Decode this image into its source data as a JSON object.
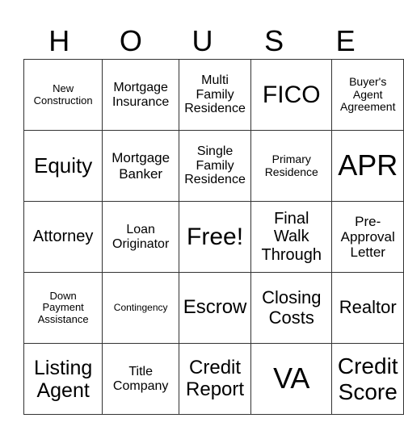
{
  "header": [
    "H",
    "O",
    "U",
    "S",
    "E"
  ],
  "cells": [
    [
      "New Construction",
      "Mortgage Insurance",
      "Multi Family Residence",
      "FICO",
      "Buyer's Agent Agreement"
    ],
    [
      "Equity",
      "Mortgage Banker",
      "Single Family Residence",
      "Primary Residence",
      "APR"
    ],
    [
      "Attorney",
      "Loan Originator",
      "Free!",
      "Final Walk Through",
      "Pre-Approval Letter"
    ],
    [
      "Down Payment Assistance",
      "Contingency",
      "Escrow",
      "Closing Costs",
      "Realtor"
    ],
    [
      "Listing Agent",
      "Title Company",
      "Credit Report",
      "VA",
      "Credit Score"
    ]
  ]
}
